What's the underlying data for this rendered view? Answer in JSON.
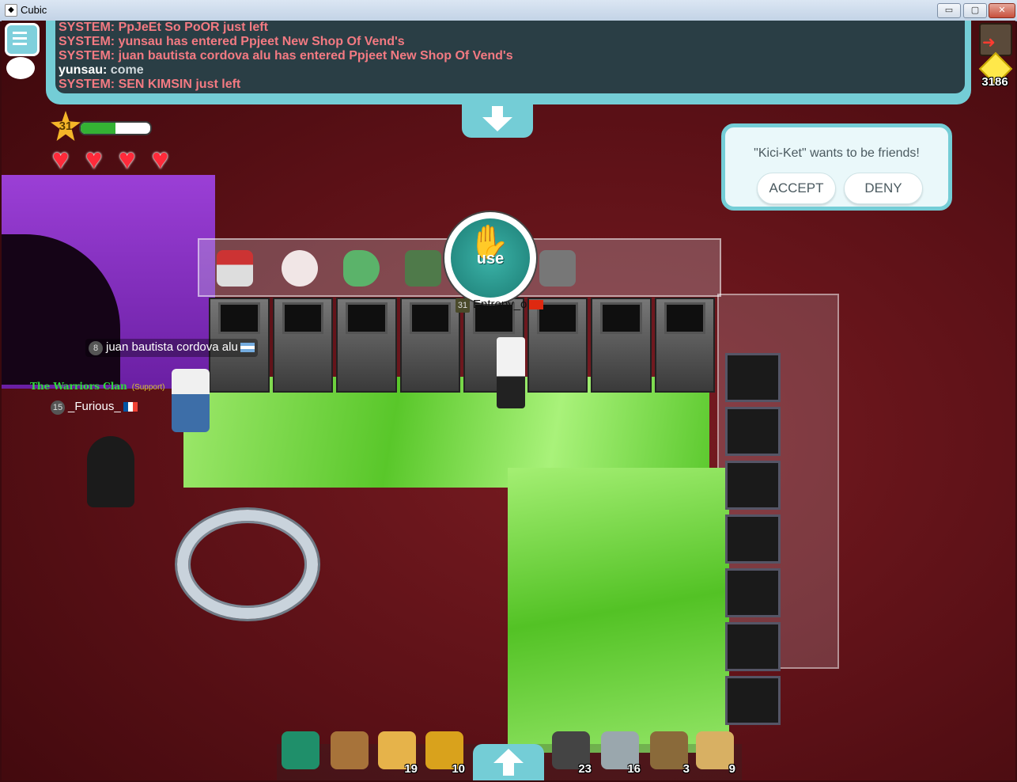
{
  "window": {
    "title": "Cubic",
    "controls": {
      "minimize": "▭",
      "maximize": "▢",
      "close": "✕"
    }
  },
  "chat": {
    "lines": [
      {
        "type": "system",
        "text": "SYSTEM: PpJeEt So PoOR just left"
      },
      {
        "type": "system",
        "text": "SYSTEM: yunsau has entered Ppjeet New Shop Of Vend's"
      },
      {
        "type": "system",
        "text": "SYSTEM: juan bautista cordova alu has entered Ppjeet New Shop Of Vend's"
      },
      {
        "type": "user",
        "name": "yunsau:",
        "message": " come"
      },
      {
        "type": "system",
        "text": "SYSTEM: SEN KIMSIN just left"
      }
    ]
  },
  "currency": {
    "cubes": "3186"
  },
  "player": {
    "level": "31",
    "xp_fraction": 0.5,
    "hearts": 4
  },
  "friend_request": {
    "message": "\"Kici-Ket\" wants to be friends!",
    "accept_label": "ACCEPT",
    "deny_label": "DENY"
  },
  "use_button": {
    "label": "use"
  },
  "nametags": {
    "juan": {
      "level": "8",
      "name": "juan bautista cordova alu"
    },
    "entropy": {
      "level": "31",
      "name": "Entropy_o"
    },
    "clan": {
      "name": "The Warriors Clan",
      "role": "(Support)"
    },
    "furious": {
      "level": "15",
      "name": "_Furious_"
    }
  },
  "toolbar": {
    "items": [
      {
        "icon": "hand-icon",
        "count": ""
      },
      {
        "icon": "scroll-quill-icon",
        "count": ""
      },
      {
        "icon": "pizza-icon",
        "count": "19"
      },
      {
        "icon": "coin-icon",
        "count": "10"
      },
      {
        "icon": "scatter-block-icon",
        "count": "23"
      },
      {
        "icon": "glass-cube-icon",
        "count": "16"
      },
      {
        "icon": "slingshot-icon",
        "count": "3"
      },
      {
        "icon": "sand-cube-icon",
        "count": "9"
      }
    ]
  },
  "colors": {
    "chat_panel": "#74cdd6",
    "system_text": "#f37a82",
    "floor_green": "#5cc92e",
    "heart": "#ff2a3a",
    "clan_text": "#2fdc3c"
  }
}
